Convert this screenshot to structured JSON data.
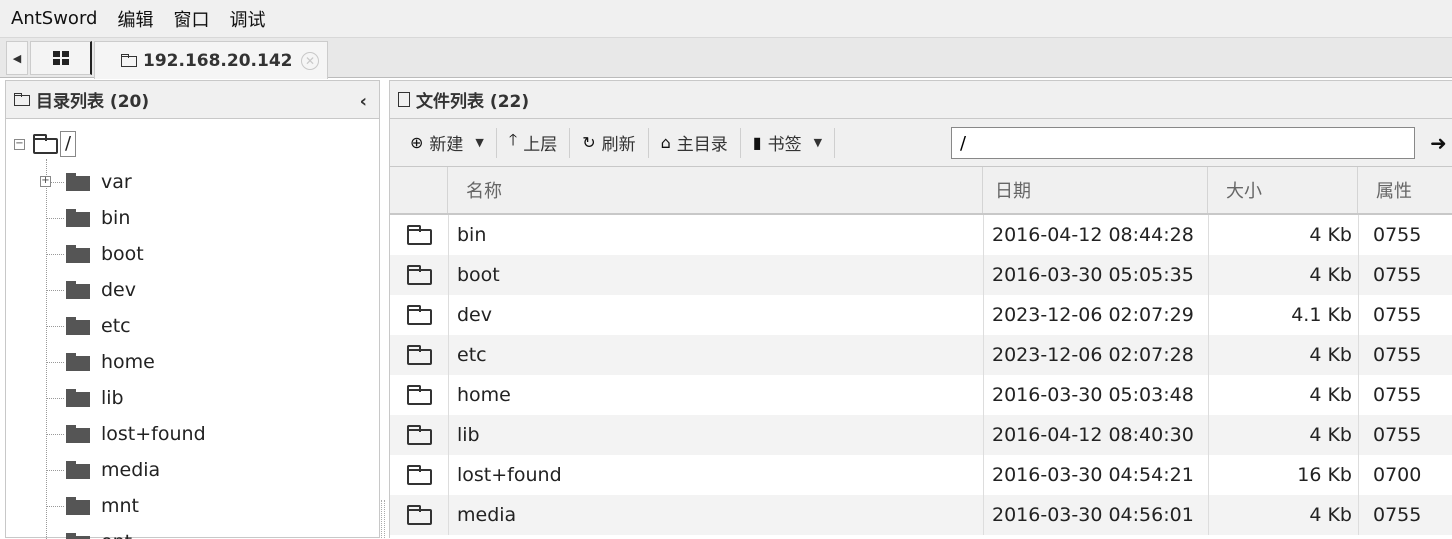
{
  "menu": {
    "items": [
      "AntSword",
      "编辑",
      "窗口",
      "调试"
    ]
  },
  "tabs": {
    "active_label": "192.168.20.142"
  },
  "left_panel": {
    "title": "目录列表 (20)",
    "root_label": "/",
    "items": [
      "var",
      "bin",
      "boot",
      "dev",
      "etc",
      "home",
      "lib",
      "lost+found",
      "media",
      "mnt",
      "opt"
    ]
  },
  "right_panel": {
    "title": "文件列表 (22)",
    "toolbar": {
      "new_label": "新建",
      "up_label": "上层",
      "refresh_label": "刷新",
      "home_label": "主目录",
      "bookmark_label": "书签",
      "path_value": "/"
    },
    "columns": {
      "name": "名称",
      "date": "日期",
      "size": "大小",
      "attr": "属性"
    },
    "rows": [
      {
        "name": "bin",
        "date": "2016-04-12 08:44:28",
        "size": "4 Kb",
        "attr": "0755"
      },
      {
        "name": "boot",
        "date": "2016-03-30 05:05:35",
        "size": "4 Kb",
        "attr": "0755"
      },
      {
        "name": "dev",
        "date": "2023-12-06 02:07:29",
        "size": "4.1 Kb",
        "attr": "0755"
      },
      {
        "name": "etc",
        "date": "2023-12-06 02:07:28",
        "size": "4 Kb",
        "attr": "0755"
      },
      {
        "name": "home",
        "date": "2016-03-30 05:03:48",
        "size": "4 Kb",
        "attr": "0755"
      },
      {
        "name": "lib",
        "date": "2016-04-12 08:40:30",
        "size": "4 Kb",
        "attr": "0755"
      },
      {
        "name": "lost+found",
        "date": "2016-03-30 04:54:21",
        "size": "16 Kb",
        "attr": "0700"
      },
      {
        "name": "media",
        "date": "2016-03-30 04:56:01",
        "size": "4 Kb",
        "attr": "0755"
      }
    ]
  }
}
